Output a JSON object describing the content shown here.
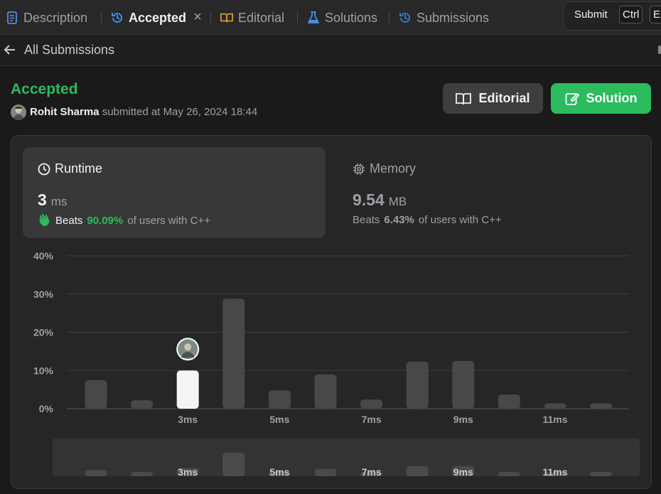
{
  "tabs": [
    {
      "label": "Description",
      "icon": "description-icon"
    },
    {
      "label": "Accepted",
      "icon": "history-icon"
    },
    {
      "label": "Editorial",
      "icon": "book-icon"
    },
    {
      "label": "Solutions",
      "icon": "flask-icon"
    },
    {
      "label": "Submissions",
      "icon": "history-icon"
    }
  ],
  "toolbar": {
    "submit_label": "Submit",
    "kbd_ctrl": "Ctrl",
    "kbd_enter": "E"
  },
  "subheader": {
    "back_label": "All Submissions"
  },
  "submission": {
    "status": "Accepted",
    "author": "Rohit Sharma",
    "submitted_text": "submitted at May 26, 2024 18:44"
  },
  "buttons": {
    "editorial": "Editorial",
    "solution": "Solution"
  },
  "runtime": {
    "title": "Runtime",
    "value": "3",
    "unit": "ms",
    "beats_label": "Beats",
    "beats_pct": "90.09%",
    "beats_suffix": "of users with C++"
  },
  "memory": {
    "title": "Memory",
    "value": "9.54",
    "unit": "MB",
    "beats_label": "Beats",
    "beats_pct": "6.43%",
    "beats_suffix": "of users with C++"
  },
  "colors": {
    "accent_green": "#2cbb5d",
    "bar": "#484848",
    "bar_selected": "#f5f5f5"
  },
  "chart_data": {
    "type": "bar",
    "metric": "runtime",
    "ylim": [
      0,
      40
    ],
    "y_ticks": [
      "40%",
      "30%",
      "20%",
      "10%",
      "0%"
    ],
    "y_tick_values": [
      40,
      30,
      20,
      10,
      0
    ],
    "x_tick_labels": [
      {
        "bin": 3,
        "label": "3ms"
      },
      {
        "bin": 5,
        "label": "5ms"
      },
      {
        "bin": 7,
        "label": "7ms"
      },
      {
        "bin": 9,
        "label": "9ms"
      },
      {
        "bin": 11,
        "label": "11ms"
      }
    ],
    "bins": [
      1,
      2,
      3,
      4,
      5,
      6,
      7,
      8,
      9,
      10,
      11,
      12
    ],
    "values": [
      7.5,
      2.2,
      10.0,
      28.8,
      4.8,
      9.0,
      2.4,
      12.3,
      12.5,
      3.7,
      1.4,
      1.4
    ],
    "selected_bin": 3,
    "grid": true
  }
}
